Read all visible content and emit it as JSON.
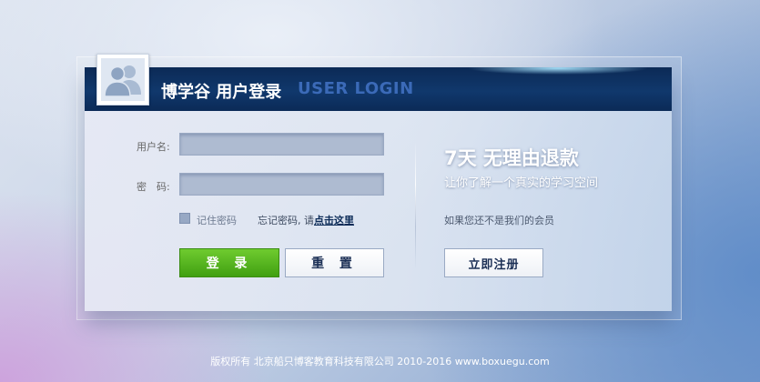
{
  "header": {
    "title": "博学谷 用户登录",
    "subtitle": "USER LOGIN"
  },
  "form": {
    "username_label": "用户名:",
    "username_value": "",
    "password_label": "密　码:",
    "password_value": "",
    "remember_label": "记住密码",
    "forgot_prefix": "忘记密码, 请",
    "forgot_link": "点击这里",
    "login_button": "登 录",
    "reset_button": "重 置"
  },
  "promo": {
    "title": "7天  无理由退款",
    "subtitle": "让你了解一个真实的学习空间",
    "member_prompt": "如果您还不是我们的会员",
    "register_button": "立即注册"
  },
  "footer": {
    "copyright": "版权所有 北京船只博客教育科技有限公司 2010-2016 www.boxuegu.com"
  },
  "icons": {
    "avatar": "user-group-icon"
  },
  "colors": {
    "header_bg": "#10386c",
    "login_green": "#41a012",
    "subtitle_blue": "#3b6ab8"
  }
}
